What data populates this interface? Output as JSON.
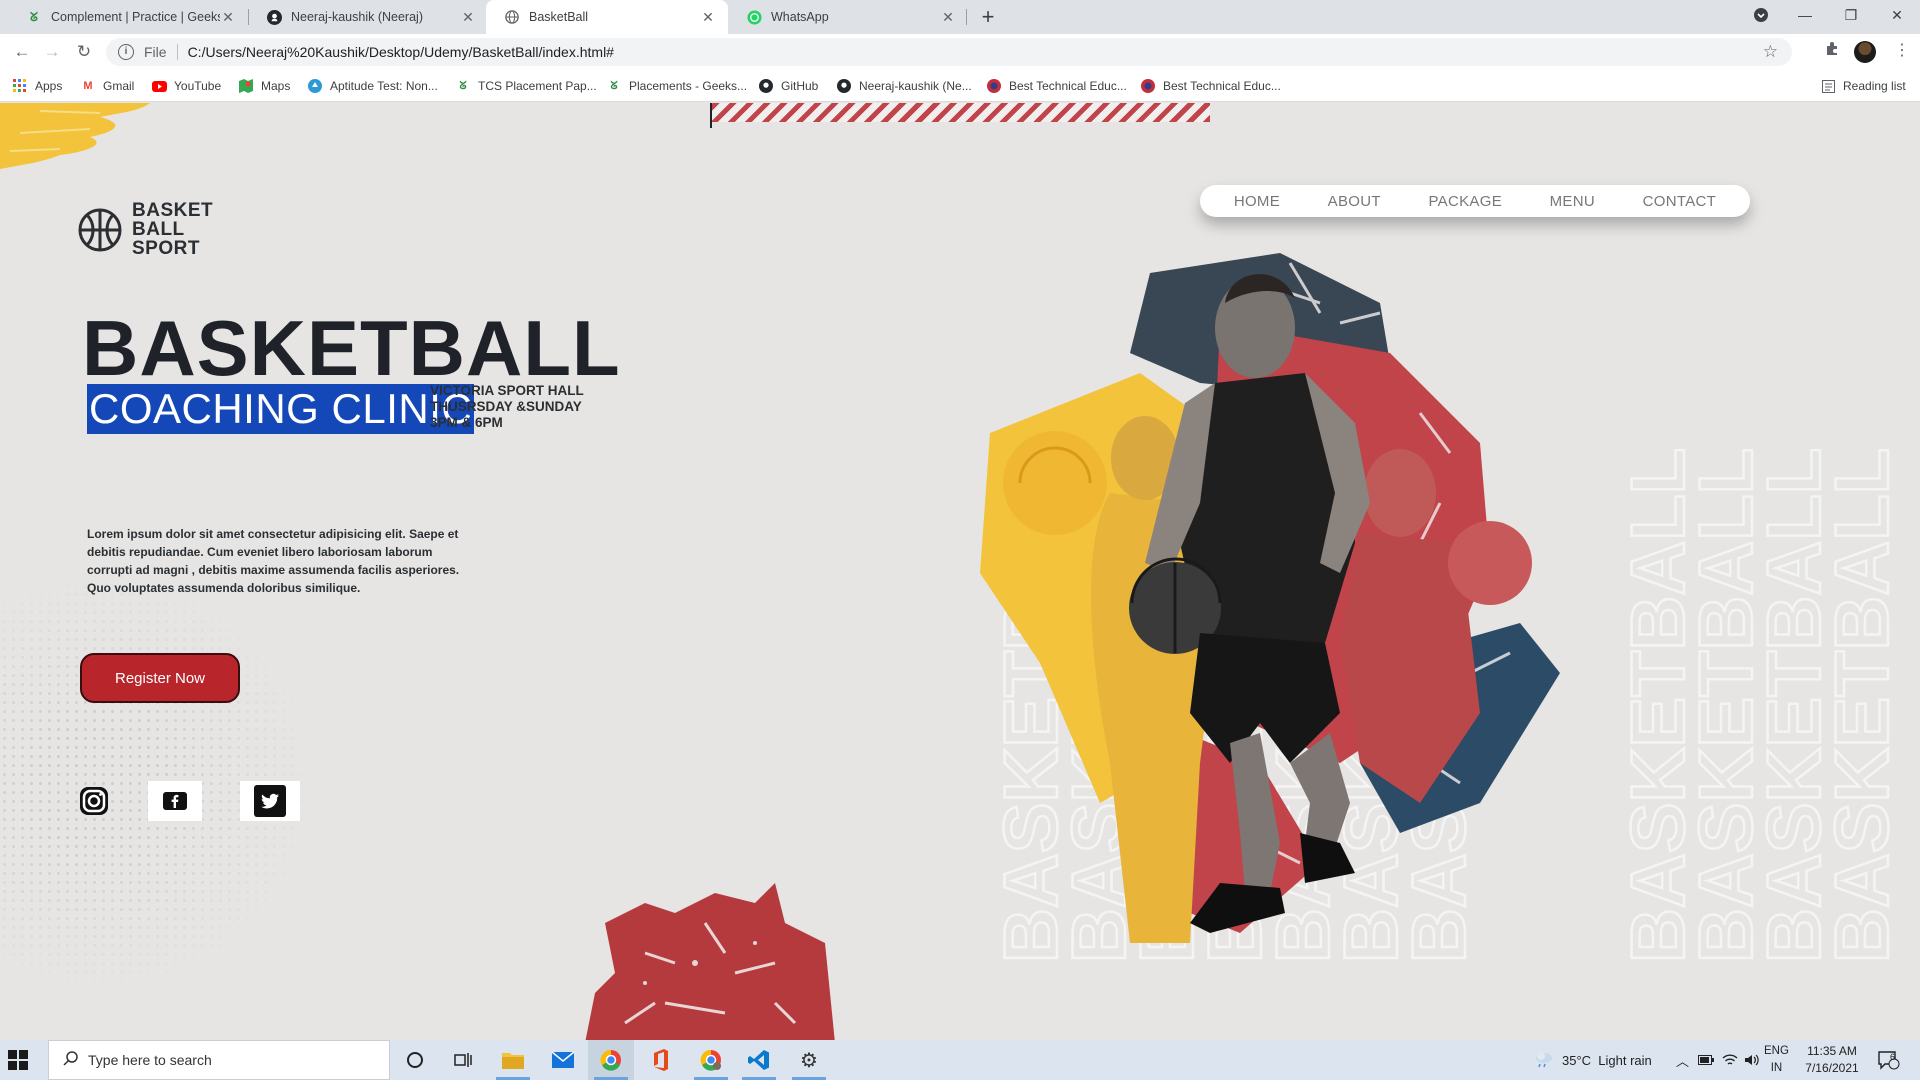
{
  "browser": {
    "tabs": [
      {
        "title": "Complement | Practice | Geeksfor",
        "icon": "gfg-icon",
        "active": false
      },
      {
        "title": "Neeraj-kaushik (Neeraj)",
        "icon": "github-icon",
        "active": false
      },
      {
        "title": "BasketBall",
        "icon": "globe-icon",
        "active": true
      },
      {
        "title": "WhatsApp",
        "icon": "whatsapp-icon",
        "active": false
      }
    ],
    "address": {
      "scheme_label": "File",
      "url": "C:/Users/Neeraj%20Kaushik/Desktop/Udemy/BasketBall/index.html#"
    },
    "bookmarks": [
      {
        "label": "Apps",
        "icon": "apps-grid-icon"
      },
      {
        "label": "Gmail",
        "icon": "gmail-icon"
      },
      {
        "label": "YouTube",
        "icon": "youtube-icon"
      },
      {
        "label": "Maps",
        "icon": "maps-icon"
      },
      {
        "label": "Aptitude Test: Non...",
        "icon": "aptitude-icon"
      },
      {
        "label": "TCS Placement Pap...",
        "icon": "gfg-icon"
      },
      {
        "label": "Placements - Geeks...",
        "icon": "gfg-icon"
      },
      {
        "label": "GitHub",
        "icon": "github-icon"
      },
      {
        "label": "Neeraj-kaushik (Ne...",
        "icon": "github-icon"
      },
      {
        "label": "Best Technical Educ...",
        "icon": "edu-icon"
      },
      {
        "label": "Best Technical Educ...",
        "icon": "edu-icon"
      }
    ],
    "reading_list": "Reading list"
  },
  "site": {
    "logo": {
      "line1": "BASKET",
      "line2": "BALL",
      "line3": "SPORT"
    },
    "nav": [
      "HOME",
      "ABOUT",
      "PACKAGE",
      "MENU",
      "CONTACT"
    ],
    "hero": {
      "title": "BASKETBALL",
      "subtitle": "COACHING CLINIC",
      "venue": "VICTORIA SPORT HALL",
      "days": "THUSRSDAY &SUNDAY",
      "time": "3PM & 6PM"
    },
    "description": "Lorem ipsum dolor sit amet consectetur adipisicing elit. Saepe et debitis repudiandae. Cum eveniet libero laboriosam laborum corrupti ad magni , debitis maxime assumenda facilis asperiores. Quo voluptates assumenda doloribus similique.",
    "cta": "Register Now",
    "background_word": "BASKETBALL",
    "colors": {
      "accent_blue": "#1448b8",
      "cta_red": "#b8262c",
      "yellow": "#f3c33b",
      "red": "#c0444a",
      "navy": "#2b4b66"
    }
  },
  "taskbar": {
    "search_placeholder": "Type here to search",
    "weather": "35°C  Light rain",
    "lang1": "ENG",
    "lang2": "IN",
    "time": "11:35 AM",
    "date": "7/16/2021",
    "notifications": "6"
  }
}
